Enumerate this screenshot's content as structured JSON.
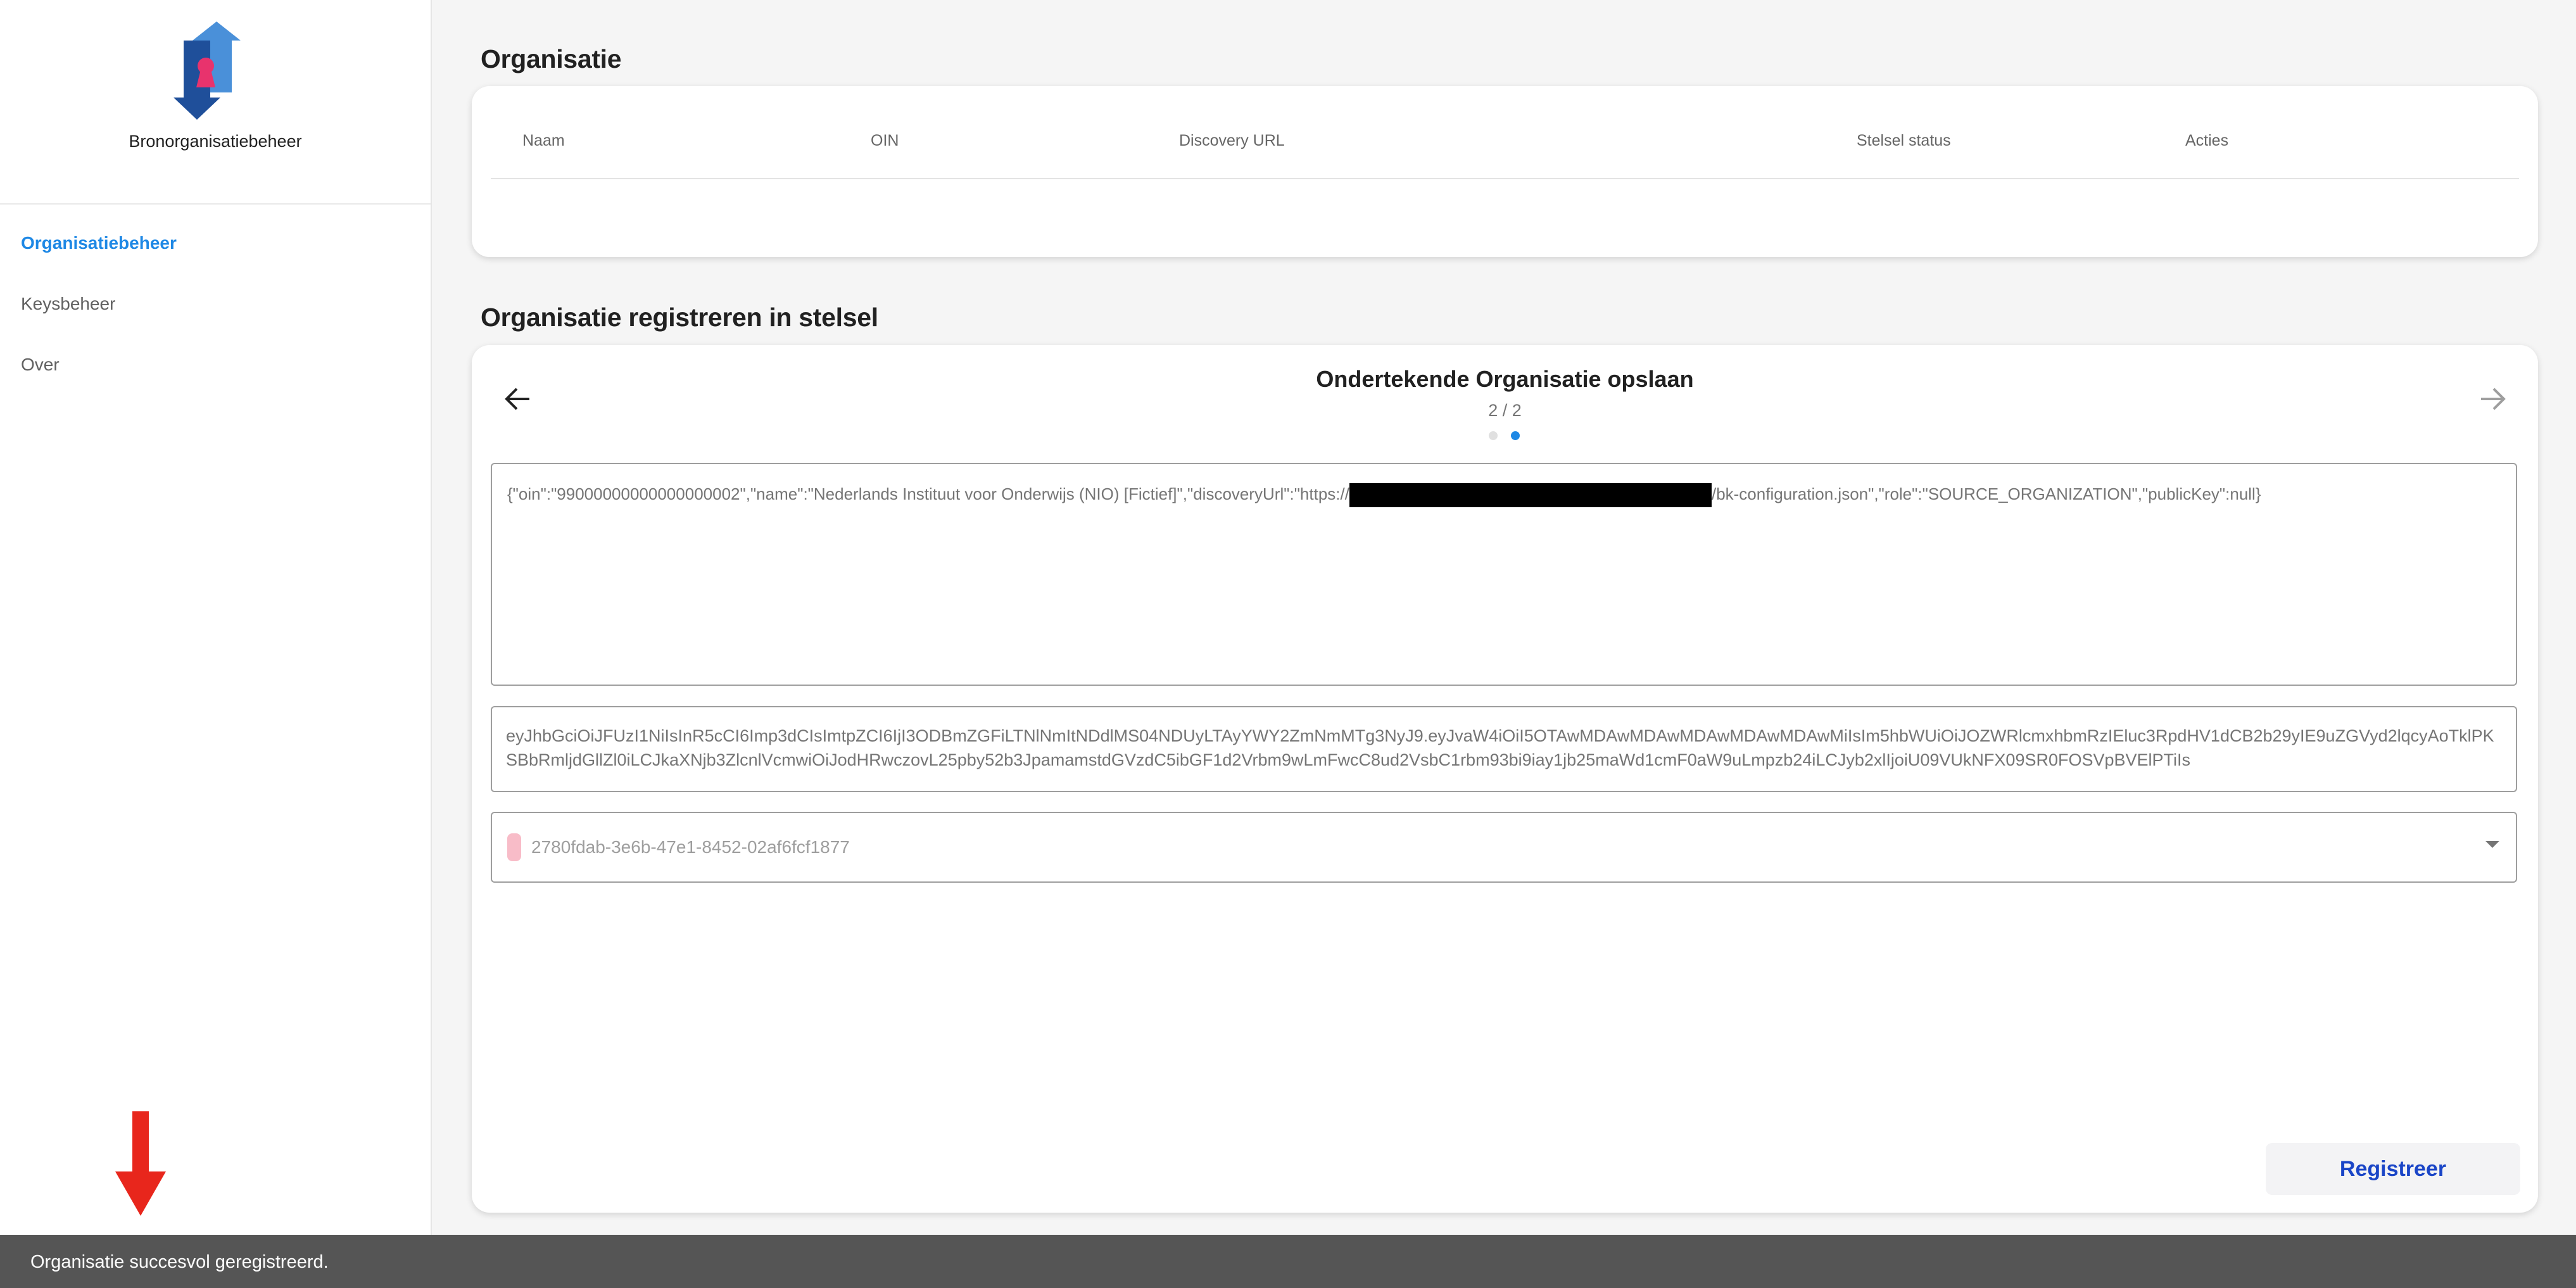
{
  "sidebar": {
    "app_name": "Bronorganisatiebeheer",
    "items": [
      {
        "label": "Organisatiebeheer",
        "active": true
      },
      {
        "label": "Keysbeheer",
        "active": false
      },
      {
        "label": "Over",
        "active": false
      }
    ]
  },
  "organisations": {
    "title": "Organisatie",
    "columns": [
      "Naam",
      "OIN",
      "Discovery URL",
      "Stelsel status",
      "Acties"
    ],
    "rows": []
  },
  "registration": {
    "title": "Organisatie registreren in stelsel",
    "step_title": "Ondertekende Organisatie opslaan",
    "step_counter": "2 / 2",
    "json_prefix": "{\"oin\":\"99000000000000000002\",\"name\":\"Nederlands Instituut voor Onderwijs (NIO) [Fictief]\",\"discoveryUrl\":\"https://",
    "json_suffix": "/bk-configuration.json\",\"role\":\"SOURCE_ORGANIZATION\",\"publicKey\":null}",
    "token": "eyJhbGciOiJFUzI1NiIsInR5cCI6Imp3dCIsImtpZCI6IjI3ODBmZGFiLTNlNmItNDdlMS04NDUyLTAyYWY2ZmNmMTg3NyJ9.eyJvaW4iOiI5OTAwMDAwMDAwMDAwMDAwMDAwMiIsIm5hbWUiOiJOZWRlcmxhbmRzIEluc3RpdHV1dCB2b29yIE9uZGVyd2lqcyAoTklPKSBbRmljdGllZl0iLCJkaXNjb3ZlcnlVcmwiOiJodHRwczovL25pby52b3JpamamstdGVzdC5ibGF1d2Vrbm9wLmFwcC8ud2VsbC1rbm93bi9iay1jb25maWd1cmF0aW9uLmpzb24iLCJyb2xlIjoiU09VUkNFX09SR0FOSVpBVElPTiIs",
    "selected_key": "2780fdab-3e6b-47e1-8452-02af6fcf1877",
    "register_label": "Registreer"
  },
  "snackbar": {
    "message": "Organisatie succesvol geregistreerd."
  },
  "colors": {
    "accent": "#1e88e5",
    "button_text": "#1a45c7",
    "logo_light_blue": "#4a90d9",
    "logo_dark_blue": "#1f4f9a",
    "logo_pink": "#e8336d",
    "annotation_arrow": "#e8261c"
  },
  "icons": {
    "back": "arrow-left-icon",
    "forward": "arrow-right-icon",
    "select": "caret-down-icon"
  }
}
